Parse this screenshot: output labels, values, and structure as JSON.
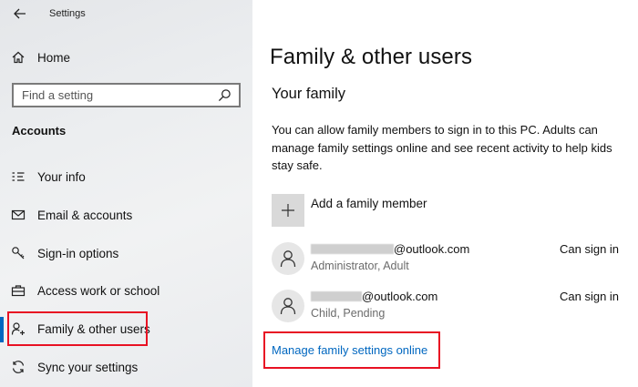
{
  "window": {
    "title": "Settings"
  },
  "sidebar": {
    "home_label": "Home",
    "search_placeholder": "Find a setting",
    "section": "Accounts",
    "items": [
      {
        "label": "Your info",
        "icon": "person-card-icon"
      },
      {
        "label": "Email & accounts",
        "icon": "mail-icon"
      },
      {
        "label": "Sign-in options",
        "icon": "key-icon"
      },
      {
        "label": "Access work or school",
        "icon": "briefcase-icon"
      },
      {
        "label": "Family & other users",
        "icon": "person-add-icon",
        "active": true
      },
      {
        "label": "Sync your settings",
        "icon": "sync-icon"
      }
    ]
  },
  "main": {
    "title": "Family & other users",
    "section_title": "Your family",
    "description": "You can allow family members to sign in to this PC. Adults can manage family settings online and see recent activity to help kids stay safe.",
    "add_member_label": "Add a family member",
    "members": [
      {
        "email_suffix": "@outlook.com",
        "subtitle": "Administrator, Adult",
        "status": "Can sign in"
      },
      {
        "email_suffix": "@outlook.com",
        "subtitle": "Child, Pending",
        "status": "Can sign in"
      }
    ],
    "manage_link": "Manage family settings online"
  },
  "colors": {
    "accent": "#0067c0",
    "highlight": "#e81123",
    "secondary_text": "#6b6b6b"
  }
}
